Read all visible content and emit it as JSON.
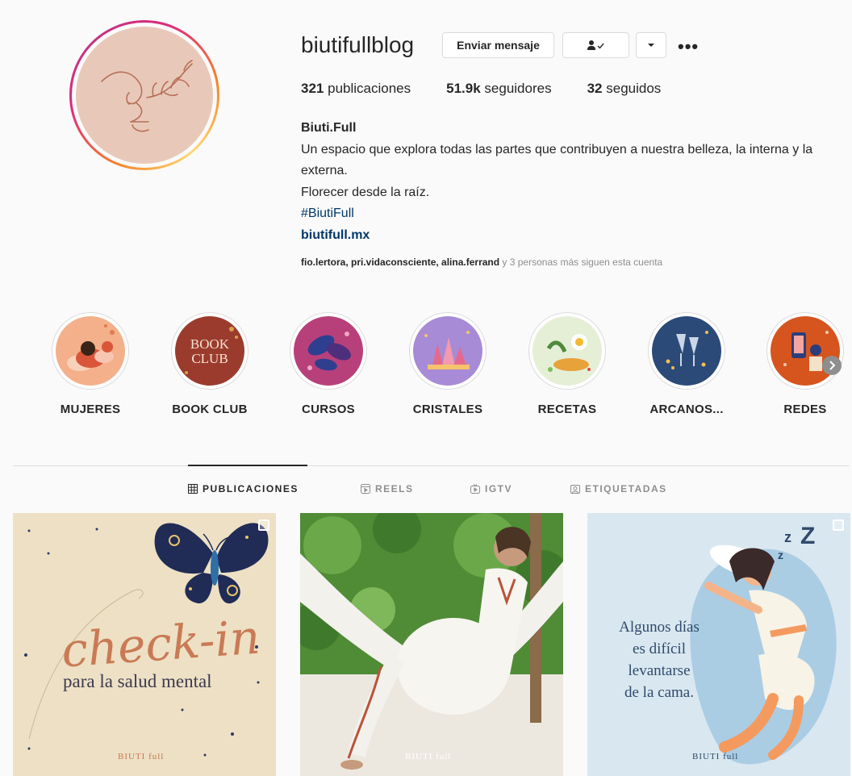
{
  "profile": {
    "username": "biutifullblog",
    "message_button": "Enviar mensaje",
    "follow_button_icon": "person-check-icon",
    "dropdown_icon": "chevron-down-icon",
    "more_icon": "more-icon",
    "more_symbol": "•••"
  },
  "stats": {
    "posts_count": "321",
    "posts_label": "publicaciones",
    "followers_count": "51.9k",
    "followers_label": "seguidores",
    "following_count": "32",
    "following_label": "seguidos"
  },
  "bio": {
    "name": "Biuti.Full",
    "line1": "Un espacio que explora todas las partes que contribuyen a nuestra belleza, la interna y la externa.",
    "line2": "Florecer desde la raíz.",
    "hashtag": "#BiutiFull",
    "link": "biutifull.mx"
  },
  "followed_by": {
    "users": "fio.lertora, pri.vidaconsciente, alina.ferrand",
    "suffix": " y 3 personas más siguen esta cuenta"
  },
  "highlights": [
    {
      "label": "MUJERES",
      "color": "#f3b08a"
    },
    {
      "label": "BOOK CLUB",
      "color": "#9b3b2e",
      "art_text": "BOOK CLUB"
    },
    {
      "label": "CURSOS",
      "color": "#b8407a"
    },
    {
      "label": "CRISTALES",
      "color": "#a78bd6"
    },
    {
      "label": "RECETAS",
      "color": "#e4efd6"
    },
    {
      "label": "ARCANOS...",
      "color": "#2c4a78"
    },
    {
      "label": "REDES",
      "color": "#d6551f"
    }
  ],
  "highlights_next_icon": "chevron-right-icon",
  "tabs": [
    {
      "label": "PUBLICACIONES",
      "icon": "grid-icon",
      "active": true
    },
    {
      "label": "REELS",
      "icon": "reels-icon",
      "active": false
    },
    {
      "label": "IGTV",
      "icon": "igtv-icon",
      "active": false
    },
    {
      "label": "ETIQUETADAS",
      "icon": "tagged-icon",
      "active": false
    }
  ],
  "posts": [
    {
      "title_script": "check-in",
      "subtitle": "para la salud mental",
      "brand": "BIUTI full"
    },
    {
      "brand": "BIUTI full"
    },
    {
      "text_lines": [
        "Algunos días",
        "es difícil",
        "levantarse",
        "de la cama."
      ],
      "brand": "BIUTI full",
      "sleep_text": "zzZ"
    }
  ]
}
